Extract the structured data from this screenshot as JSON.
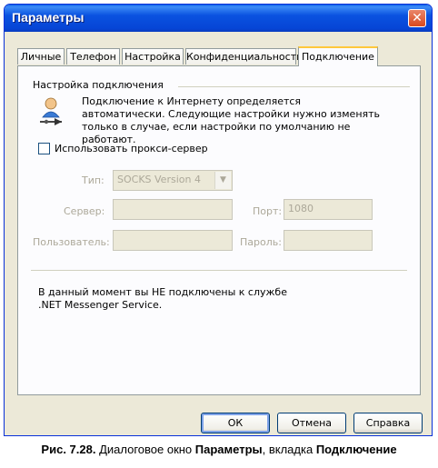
{
  "window": {
    "title": "Параметры",
    "close_symbol": "✕"
  },
  "tabs": [
    {
      "label": "Личные"
    },
    {
      "label": "Телефон"
    },
    {
      "label": "Настройка"
    },
    {
      "label": "Конфиденциальность"
    },
    {
      "label": "Подключение",
      "active": true
    }
  ],
  "connection": {
    "group_title": "Настройка подключения",
    "info_text": "Подключение к Интернету определяется автоматически. Следующие настройки нужно изменять только в случае, если настройки по умолчанию не работают.",
    "info_icon": "user-network-icon",
    "proxy_checkbox": {
      "label": "Использовать прокси-сервер",
      "checked": false
    },
    "type": {
      "label": "Тип:",
      "value": "SOCKS Version 4"
    },
    "server": {
      "label": "Сервер:",
      "value": ""
    },
    "port": {
      "label": "Порт:",
      "value": "1080"
    },
    "user": {
      "label": "Пользователь:",
      "value": ""
    },
    "password": {
      "label": "Пароль:",
      "value": ""
    },
    "status_text": "В данный момент вы НЕ подключены к службе .NET Messenger Service."
  },
  "buttons": {
    "ok": "ОК",
    "cancel": "Отмена",
    "help": "Справка"
  },
  "caption": {
    "prefix": "Рис. 7.28.",
    "text1": " Диалоговое окно ",
    "bold1": "Параметры",
    "text2": ", вкладка ",
    "bold2": "Подключение"
  },
  "colors": {
    "title_bar": "#0a52e0",
    "dialog_bg": "#ece9d8",
    "active_tab_accent": "#ffc83c",
    "disabled_text": "#aca899"
  }
}
